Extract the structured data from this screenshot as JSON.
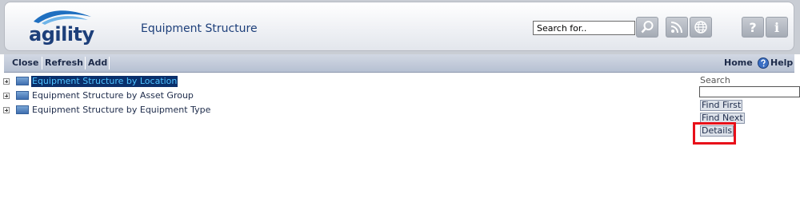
{
  "header": {
    "logo_text": "agility",
    "title": "Equipment Structure",
    "search_value": "Search for..",
    "icons": [
      "search-icon",
      "rss-icon",
      "globe-icon",
      "help-icon",
      "info-icon"
    ],
    "help_glyph": "?",
    "info_glyph": "i"
  },
  "toolbar": {
    "close": "Close",
    "refresh": "Refresh",
    "add": "Add",
    "home": "Home",
    "help": "Help"
  },
  "tree": {
    "items": [
      {
        "label": "Equipment Structure by Location",
        "selected": true
      },
      {
        "label": "Equipment Structure by Asset Group",
        "selected": false
      },
      {
        "label": "Equipment Structure by Equipment Type",
        "selected": false
      }
    ]
  },
  "search_panel": {
    "label": "Search",
    "input_value": "",
    "find_first": "Find First",
    "find_next": "Find Next",
    "details": "Details"
  },
  "colors": {
    "highlight": "#e8101a",
    "selected_bg": "#0a2f6b",
    "selected_text": "#4fc3ff",
    "brand": "#1d3f7a"
  }
}
